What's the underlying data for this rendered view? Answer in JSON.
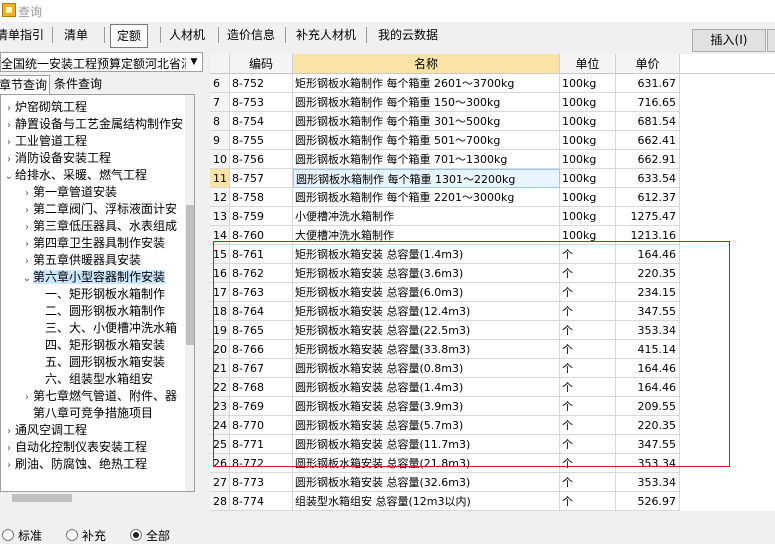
{
  "window": {
    "title": "查询"
  },
  "tabs": [
    {
      "label": "清单指引",
      "active": false
    },
    {
      "label": "清单",
      "active": false
    },
    {
      "label": "定额",
      "active": true
    },
    {
      "label": "人材机",
      "active": false
    },
    {
      "label": "造价信息",
      "active": false
    },
    {
      "label": "补充人材机",
      "active": false
    },
    {
      "label": "我的云数据",
      "active": false
    }
  ],
  "insert_button": "插入(I)",
  "left_panel": {
    "library": "全国统一安装工程预算定额河北省消",
    "subtabs": [
      {
        "label": "章节查询",
        "active": true
      },
      {
        "label": "条件查询",
        "active": false
      }
    ],
    "tree": [
      {
        "label": "炉窑砌筑工程",
        "toggle": "›"
      },
      {
        "label": "静置设备与工艺金属结构制作安",
        "toggle": "›"
      },
      {
        "label": "工业管道工程",
        "toggle": "›"
      },
      {
        "label": "消防设备安装工程",
        "toggle": "›"
      },
      {
        "label": "给排水、采暖、燃气工程",
        "toggle": "⌄"
      },
      {
        "label": "第一章管道安装",
        "toggle": "›"
      },
      {
        "label": "第二章阀门、浮标液面计安",
        "toggle": "›"
      },
      {
        "label": "第三章低压器具、水表组成",
        "toggle": "›"
      },
      {
        "label": "第四章卫生器具制作安装",
        "toggle": "›"
      },
      {
        "label": "第五章供暖器具安装",
        "toggle": "›"
      },
      {
        "label": "第六章小型容器制作安装",
        "toggle": "⌄",
        "selected": true
      },
      {
        "label": "一、矩形钢板水箱制作",
        "toggle": ""
      },
      {
        "label": "二、圆形钢板水箱制作",
        "toggle": ""
      },
      {
        "label": "三、大、小便槽冲洗水箱",
        "toggle": ""
      },
      {
        "label": "四、矩形钢板水箱安装",
        "toggle": ""
      },
      {
        "label": "五、圆形钢板水箱安装",
        "toggle": ""
      },
      {
        "label": "六、组装型水箱组安",
        "toggle": ""
      },
      {
        "label": "第七章燃气管道、附件、器",
        "toggle": "›"
      },
      {
        "label": "第八章可竞争措施项目",
        "toggle": ""
      },
      {
        "label": "通风空调工程",
        "toggle": "›"
      },
      {
        "label": "自动化控制仪表安装工程",
        "toggle": "›"
      },
      {
        "label": "刷油、防腐蚀、绝热工程",
        "toggle": "›"
      }
    ],
    "radios": [
      {
        "label": "标准",
        "checked": false
      },
      {
        "label": "补充",
        "checked": false
      },
      {
        "label": "全部",
        "checked": true
      }
    ]
  },
  "table": {
    "headers": [
      "编码",
      "名称",
      "单位",
      "单价"
    ],
    "rows": [
      {
        "n": "6",
        "code": "8-752",
        "name": "矩形钢板水箱制作 每个箱重 2601～3700kg",
        "unit": "100kg",
        "price": "631.67"
      },
      {
        "n": "7",
        "code": "8-753",
        "name": "圆形钢板水箱制作 每个箱重 150～300kg",
        "unit": "100kg",
        "price": "716.65"
      },
      {
        "n": "8",
        "code": "8-754",
        "name": "圆形钢板水箱制作 每个箱重 301～500kg",
        "unit": "100kg",
        "price": "681.54"
      },
      {
        "n": "9",
        "code": "8-755",
        "name": "圆形钢板水箱制作 每个箱重 501～700kg",
        "unit": "100kg",
        "price": "662.41"
      },
      {
        "n": "10",
        "code": "8-756",
        "name": "圆形钢板水箱制作 每个箱重 701～1300kg",
        "unit": "100kg",
        "price": "662.91"
      },
      {
        "n": "11",
        "code": "8-757",
        "name": "圆形钢板水箱制作 每个箱重 1301～2200kg",
        "unit": "100kg",
        "price": "633.54",
        "current": true
      },
      {
        "n": "12",
        "code": "8-758",
        "name": "圆形钢板水箱制作 每个箱重 2201～3000kg",
        "unit": "100kg",
        "price": "612.37"
      },
      {
        "n": "13",
        "code": "8-759",
        "name": "小便槽冲洗水箱制作",
        "unit": "100kg",
        "price": "1275.47"
      },
      {
        "n": "14",
        "code": "8-760",
        "name": "大便槽冲洗水箱制作",
        "unit": "100kg",
        "price": "1213.16"
      },
      {
        "n": "15",
        "code": "8-761",
        "name": "矩形钢板水箱安装 总容量(1.4m3)",
        "unit": "个",
        "price": "164.46"
      },
      {
        "n": "16",
        "code": "8-762",
        "name": "矩形钢板水箱安装 总容量(3.6m3)",
        "unit": "个",
        "price": "220.35"
      },
      {
        "n": "17",
        "code": "8-763",
        "name": "矩形钢板水箱安装 总容量(6.0m3)",
        "unit": "个",
        "price": "234.15"
      },
      {
        "n": "18",
        "code": "8-764",
        "name": "矩形钢板水箱安装 总容量(12.4m3)",
        "unit": "个",
        "price": "347.55"
      },
      {
        "n": "19",
        "code": "8-765",
        "name": "矩形钢板水箱安装 总容量(22.5m3)",
        "unit": "个",
        "price": "353.34"
      },
      {
        "n": "20",
        "code": "8-766",
        "name": "矩形钢板水箱安装 总容量(33.8m3)",
        "unit": "个",
        "price": "415.14"
      },
      {
        "n": "21",
        "code": "8-767",
        "name": "圆形钢板水箱安装 总容量(0.8m3)",
        "unit": "个",
        "price": "164.46"
      },
      {
        "n": "22",
        "code": "8-768",
        "name": "圆形钢板水箱安装 总容量(1.4m3)",
        "unit": "个",
        "price": "164.46"
      },
      {
        "n": "23",
        "code": "8-769",
        "name": "圆形钢板水箱安装 总容量(3.9m3)",
        "unit": "个",
        "price": "209.55"
      },
      {
        "n": "24",
        "code": "8-770",
        "name": "圆形钢板水箱安装 总容量(5.7m3)",
        "unit": "个",
        "price": "220.35"
      },
      {
        "n": "25",
        "code": "8-771",
        "name": "圆形钢板水箱安装 总容量(11.7m3)",
        "unit": "个",
        "price": "347.55"
      },
      {
        "n": "26",
        "code": "8-772",
        "name": "圆形钢板水箱安装 总容量(21.8m3)",
        "unit": "个",
        "price": "353.34"
      },
      {
        "n": "27",
        "code": "8-773",
        "name": "圆形钢板水箱安装 总容量(32.6m3)",
        "unit": "个",
        "price": "353.34"
      },
      {
        "n": "28",
        "code": "8-774",
        "name": "组装型水箱组安 总容量(12m3以内)",
        "unit": "个",
        "price": "526.97"
      }
    ]
  },
  "colors": {
    "highlight_box": "#e0141e",
    "selected_header": "#fbe2a6"
  }
}
